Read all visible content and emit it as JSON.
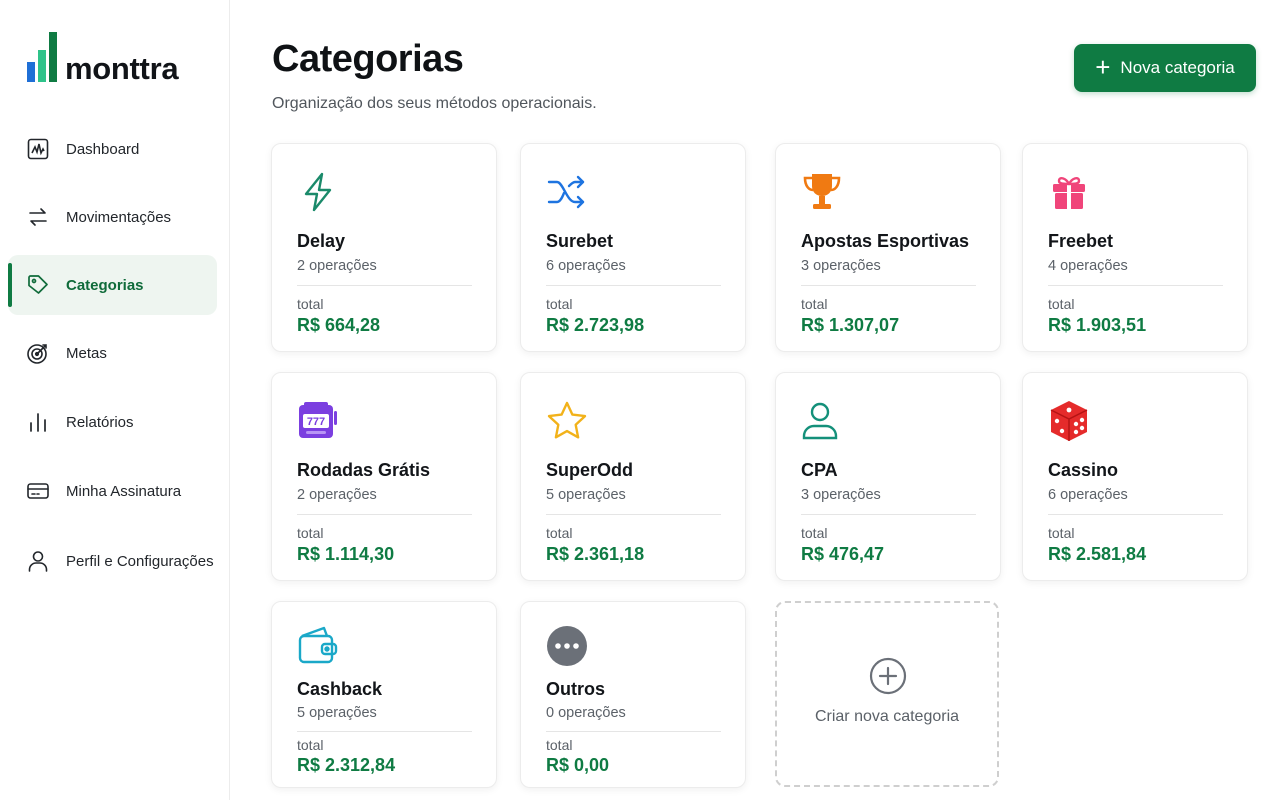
{
  "brand": {
    "name": "monttra",
    "colors": {
      "bar1": "#1f6fd6",
      "bar2": "#2fc38a",
      "bar3": "#0f7b43"
    }
  },
  "nav": {
    "items": [
      {
        "label": "Dashboard",
        "icon": "dashboard-icon",
        "active": false
      },
      {
        "label": "Movimentações",
        "icon": "transfer-arrows-icon",
        "active": false
      },
      {
        "label": "Categorias",
        "icon": "tag-icon",
        "active": true
      },
      {
        "label": "Metas",
        "icon": "target-icon",
        "active": false
      },
      {
        "label": "Relatórios",
        "icon": "bar-chart-icon",
        "active": false
      },
      {
        "label": "Minha Assinatura",
        "icon": "credit-card-icon",
        "active": false
      },
      {
        "label": "Perfil e Configurações",
        "icon": "user-icon",
        "active": false
      }
    ]
  },
  "header": {
    "title": "Categorias",
    "subtitle": "Organização dos seus métodos operacionais.",
    "new_button": "Nova categoria"
  },
  "accent": "#0f7b43",
  "categories": [
    {
      "name": "Delay",
      "operations": "2 operações",
      "total_label": "total",
      "total": "R$ 664,28",
      "icon": "lightning-icon",
      "color": "#1a8a6a"
    },
    {
      "name": "Surebet",
      "operations": "6 operações",
      "total_label": "total",
      "total": "R$ 2.723,98",
      "icon": "shuffle-icon",
      "color": "#1e74e0"
    },
    {
      "name": "Apostas Esportivas",
      "operations": "3 operações",
      "total_label": "total",
      "total": "R$ 1.307,07",
      "icon": "trophy-icon",
      "color": "#f07a12"
    },
    {
      "name": "Freebet",
      "operations": "4 operações",
      "total_label": "total",
      "total": "R$ 1.903,51",
      "icon": "gift-icon",
      "color": "#f0457a"
    },
    {
      "name": "Rodadas Grátis",
      "operations": "2 operações",
      "total_label": "total",
      "total": "R$ 1.114,30",
      "icon": "slot-machine-icon",
      "color": "#7b3fe0",
      "slot_text": "777"
    },
    {
      "name": "SuperOdd",
      "operations": "5 operações",
      "total_label": "total",
      "total": "R$ 2.361,18",
      "icon": "star-icon",
      "color": "#f2b21a"
    },
    {
      "name": "CPA",
      "operations": "3 operações",
      "total_label": "total",
      "total": "R$ 476,47",
      "icon": "user-icon",
      "color": "#14907a"
    },
    {
      "name": "Cassino",
      "operations": "6 operações",
      "total_label": "total",
      "total": "R$ 2.581,84",
      "icon": "dice-icon",
      "color": "#e52b2b"
    },
    {
      "name": "Cashback",
      "operations": "5 operações",
      "total_label": "total",
      "total": "R$ 2.312,84",
      "icon": "wallet-icon",
      "color": "#1aa8c8"
    },
    {
      "name": "Outros",
      "operations": "0 operações",
      "total_label": "total",
      "total": "R$ 0,00",
      "icon": "more-dots-icon",
      "color": "#6b7078"
    }
  ],
  "create_card": {
    "label": "Criar nova categoria"
  }
}
